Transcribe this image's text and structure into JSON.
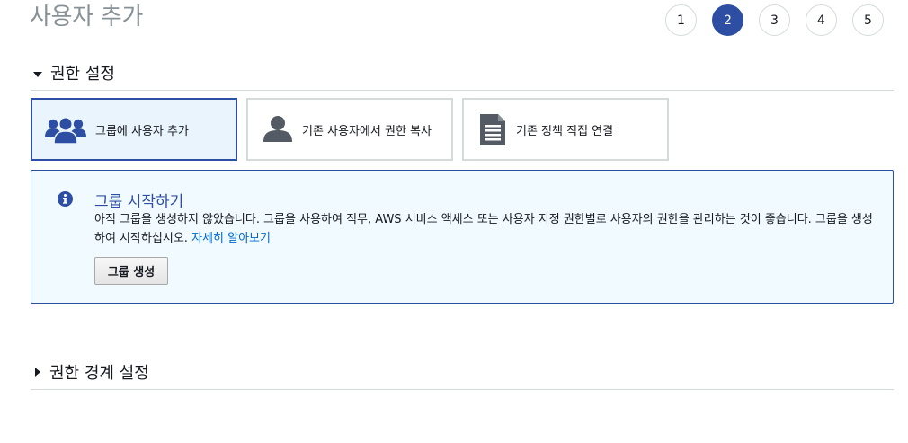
{
  "page": {
    "title": "사용자 추가"
  },
  "steps": [
    "1",
    "2",
    "3",
    "4",
    "5"
  ],
  "active_step": "2",
  "permissions": {
    "header": "권한 설정",
    "options": [
      {
        "label": "그룹에 사용자 추가",
        "icon": "group-icon",
        "selected": true
      },
      {
        "label": "기존 사용자에서 권한 복사",
        "icon": "user-icon",
        "selected": false
      },
      {
        "label": "기존 정책 직접 연결",
        "icon": "document-icon",
        "selected": false
      }
    ]
  },
  "info": {
    "icon": "info-icon",
    "title": "그룹 시작하기",
    "body": "아직 그룹을 생성하지 않았습니다. 그룹을 사용하여 직무, AWS 서비스 액세스 또는 사용자 지정 권한별로 사용자의 권한을 관리하는 것이 좋습니다. 그룹을 생성하여 시작하십시오.",
    "link": "자세히 알아보기",
    "button": "그룹 생성"
  },
  "boundary": {
    "header": "권한 경계 설정"
  },
  "colors": {
    "accent": "#2d4ea2",
    "link": "#0066cc",
    "selected_bg": "#eaf4fd",
    "info_bg": "#f1faff",
    "border": "#d5dbdb"
  }
}
